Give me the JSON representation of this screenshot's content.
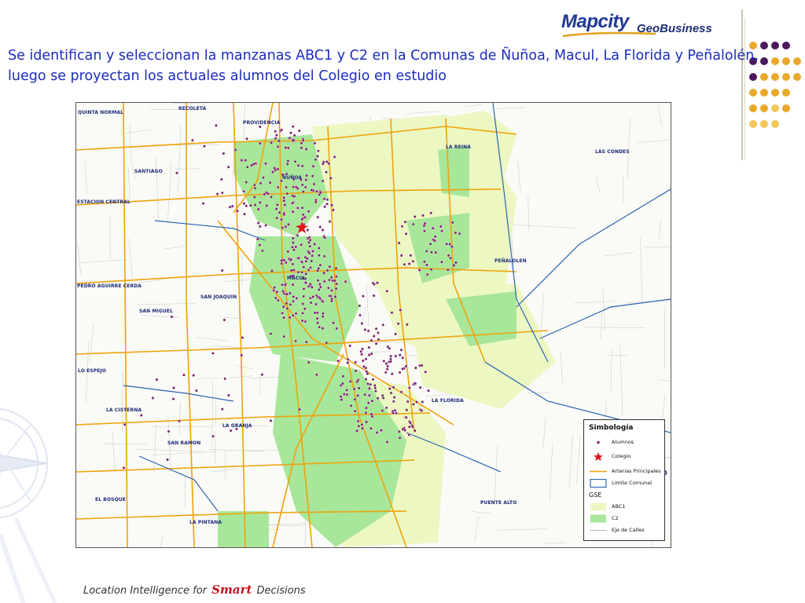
{
  "header": {
    "brand_main": "Mapcity",
    "brand_sub": "GeoBusiness",
    "headline": "Se identifican y seleccionan la manzanas ABC1 y C2 en la Comunas de Ñuñoa, Macul, La Florida y Peñalolén, luego se proyectan los actuales alumnos del Colegio en estudio"
  },
  "map": {
    "comunas": {
      "quinta_normal": "QUINTA NORMAL",
      "recoleta": "RECOLETA",
      "providencia": "PROVIDENCIA",
      "santiago": "SANTIAGO",
      "nunoa": "ÑUÑOA",
      "la_reina": "LA REINA",
      "las_condes": "LAS CONDES",
      "estacion_central": "ESTACION CENTRAL",
      "penalolen": "PEÑALOLEN",
      "pedro_aguirre_cerda": "PEDRO AGUIRRE CERDA",
      "macul": "MACUL",
      "san_joaquin": "SAN JOAQUIN",
      "san_miguel": "SAN MIGUEL",
      "lo_espejo": "LO ESPEJO",
      "la_florida": "LA FLORIDA",
      "la_cisterna": "LA CISTERNA",
      "la_granja": "LA GRANJA",
      "san_ramon": "SAN RAMON",
      "el_bosque": "EL BOSQUE",
      "puente_alto": "PUENTE ALTO",
      "la_pintana": "LA PINTANA"
    },
    "edge_mark": "O",
    "colors": {
      "abc1": "#ecf7c2",
      "c2": "#a8e69a",
      "arterial": "#f0a20a",
      "commune_border": "#2a64b0",
      "street": "#b9b9b9",
      "student": "#7a1b6b",
      "school": "#e3141b"
    }
  },
  "legend": {
    "title": "Simbología",
    "alumnos": "Alumnos",
    "colegio": "Colegio",
    "arterias": "Arterias Principales",
    "limite": "Limite Comunal",
    "gse": "GSE",
    "abc1": "ABC1",
    "c2": "C2",
    "eje": "Eje de Calles"
  },
  "footer": {
    "before": "Location Intelligence for",
    "smart": "Smart",
    "after": "Decisions"
  },
  "decor": {
    "dot_purple": "#4b1a5c",
    "dot_gold": "#e8a92a",
    "dot_pale": "#f2c65a"
  }
}
